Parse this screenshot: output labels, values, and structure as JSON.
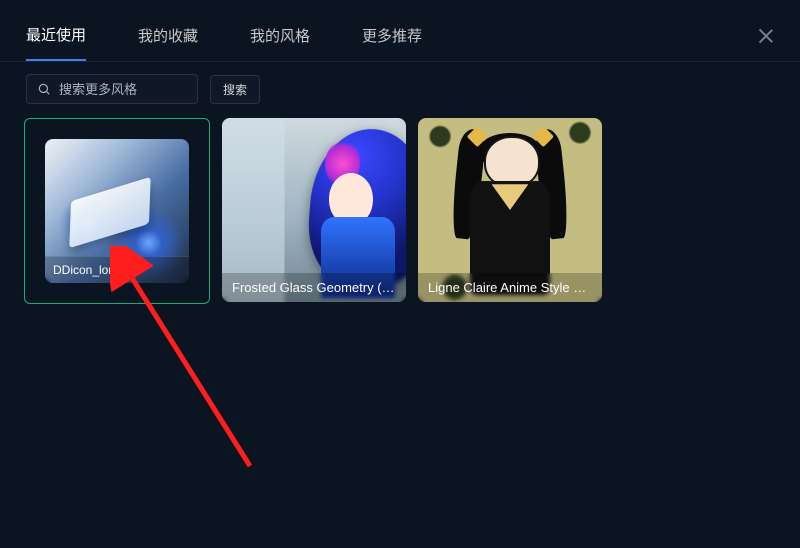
{
  "tabs": {
    "recent": "最近使用",
    "favorites": "我的收藏",
    "my_styles": "我的风格",
    "more": "更多推荐",
    "active": "recent"
  },
  "search": {
    "placeholder": "搜索更多风格",
    "button": "搜索"
  },
  "cards": [
    {
      "title": "DDicon_lora"
    },
    {
      "title": "Frosted Glass Geometry (mic..."
    },
    {
      "title": "Ligne Claire Anime Style LoRA"
    }
  ]
}
